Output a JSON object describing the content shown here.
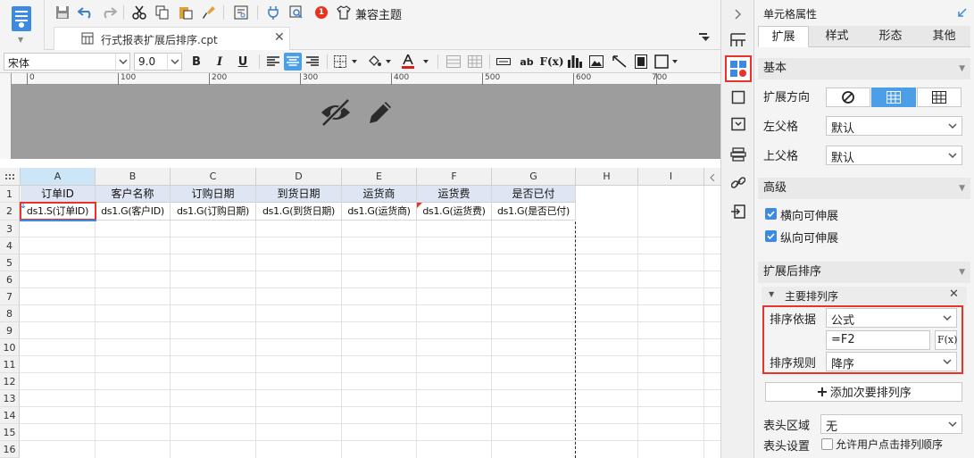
{
  "file": {
    "tab_name": "行式报表扩展后排序.cpt"
  },
  "toolbar": {
    "notification_count": "1",
    "theme_label": "兼容主题"
  },
  "format": {
    "font_name": "宋体",
    "font_size": "9.0",
    "font_icon_label": "F(x)",
    "ab_label": "ab"
  },
  "ruler": {
    "labels": [
      "0",
      "100",
      "200",
      "300",
      "400",
      "500",
      "600",
      "700"
    ]
  },
  "grid": {
    "columns": [
      "A",
      "B",
      "C",
      "D",
      "E",
      "F",
      "G",
      "H",
      "I"
    ],
    "rows": [
      "1",
      "2",
      "3",
      "4",
      "5",
      "6",
      "7",
      "8",
      "9",
      "10",
      "11",
      "12",
      "13",
      "14",
      "15",
      "16"
    ],
    "header_row": [
      "订单ID",
      "客户名称",
      "订购日期",
      "到货日期",
      "运货商",
      "运货费",
      "是否已付"
    ],
    "data_row": [
      "ds1.S(订单ID)",
      "ds1.G(客户ID)",
      "ds1.G(订购日期)",
      "ds1.G(到货日期)",
      "ds1.G(运货商)",
      "ds1.G(运货费)",
      "ds1.G(是否已付)"
    ]
  },
  "panel": {
    "title": "单元格属性",
    "tabs": [
      "扩展",
      "样式",
      "形态",
      "其他"
    ],
    "basic": {
      "section": "基本",
      "expand_dir_label": "扩展方向",
      "left_parent_label": "左父格",
      "left_parent_value": "默认",
      "upper_parent_label": "上父格",
      "upper_parent_value": "默认"
    },
    "advanced": {
      "section": "高级",
      "horizontal_label": "横向可伸展",
      "vertical_label": "纵向可伸展"
    },
    "sort": {
      "section": "扩展后排序",
      "primary_label": "主要排列序",
      "basis_label": "排序依据",
      "basis_value": "公式",
      "formula_value": "=F2",
      "fx_label": "F(x)",
      "rule_label": "排序规则",
      "rule_value": "降序",
      "add_secondary": "添加次要排列序"
    },
    "header": {
      "area_label": "表头区域",
      "area_value": "无",
      "setting_label": "表头设置",
      "allow_label": "允许用户点击排列顺序"
    }
  },
  "colors": {
    "accent": "#4c9ee6",
    "highlight": "#e8332c",
    "header_fill": "#dfe6f3"
  }
}
